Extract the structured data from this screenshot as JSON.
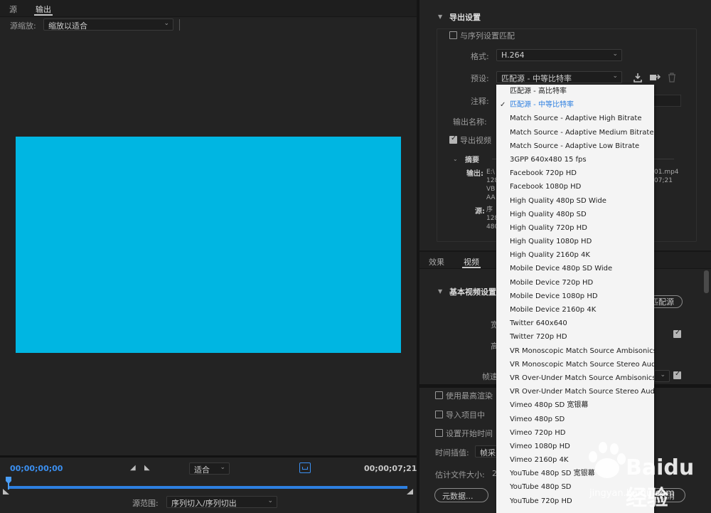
{
  "left_panel": {
    "tabs": [
      "源",
      "输出"
    ],
    "source_scale_label": "源缩放:",
    "source_scale_value": "缩放以适合",
    "preview_color": "#00b6e2",
    "timecode_in": "00;00;00;00",
    "timecode_out": "00;00;07;21",
    "fit_value": "适合",
    "source_range_label": "源范围:",
    "source_range_value": "序列切入/序列切出"
  },
  "export_settings": {
    "header": "导出设置",
    "match_sequence_label": "与序列设置匹配",
    "format_label": "格式:",
    "format_value": "H.264",
    "preset_label": "预设:",
    "preset_value": "匹配源 - 中等比特率",
    "comment_label": "注释:",
    "output_name_label": "输出名称:",
    "export_video_label": "导出视频",
    "summary": {
      "header": "摘要",
      "output_label": "输出:",
      "output_lines": [
        "E:\\",
        "128",
        "VB",
        "AA"
      ],
      "output_right": [
        "01.mp4",
        "07;21"
      ],
      "source_label": "源:",
      "source_lines": [
        "序",
        "128",
        "480"
      ]
    }
  },
  "effects_tabs": {
    "effects": "效果",
    "video": "视频",
    "basic_video_header": "基本视频设置",
    "match_source_button": "匹配源",
    "width_label_partial": "宽",
    "height_label_partial": "高",
    "frame_rate_label_partial": "帧速"
  },
  "bottom_options": {
    "max_render_label": "使用最高渲染",
    "import_project_label": "导入项目中",
    "set_start_time_label": "设置开始时间",
    "time_interpolation_label": "时间插值:",
    "time_interpolation_value": "帧采",
    "file_size_label": "估计文件大小:",
    "file_size_value": "2",
    "metadata_button": "元数据...",
    "cancel_button": "取消"
  },
  "preset_menu": {
    "selected_index": 1,
    "items": [
      "匹配源 - 高比特率",
      "匹配源 - 中等比特率",
      "Match Source - Adaptive High Bitrate",
      "Match Source - Adaptive Medium Bitrate",
      "Match Source - Adaptive Low Bitrate",
      "3GPP 640x480 15 fps",
      "Facebook 720p HD",
      "Facebook 1080p HD",
      "High Quality 480p SD Wide",
      "High Quality 480p SD",
      "High Quality 720p HD",
      "High Quality 1080p HD",
      "High Quality 2160p 4K",
      "Mobile Device 480p SD Wide",
      "Mobile Device 720p HD",
      "Mobile Device 1080p HD",
      "Mobile Device 2160p 4K",
      "Twitter 640x640",
      "Twitter 720p HD",
      "VR Monoscopic Match Source Ambisonics",
      "VR Monoscopic Match Source Stereo Audio",
      "VR Over-Under Match Source Ambisonics",
      "VR Over-Under Match Source Stereo Audio",
      "Vimeo 480p SD 宽银幕",
      "Vimeo 480p SD",
      "Vimeo 720p HD",
      "Vimeo 1080p HD",
      "Vimeo 2160p 4K",
      "YouTube 480p SD 宽银幕",
      "YouTube 480p SD",
      "YouTube 720p HD"
    ]
  },
  "watermark": {
    "text": "Baidu经验",
    "url": "jingyan.baidu.com"
  }
}
